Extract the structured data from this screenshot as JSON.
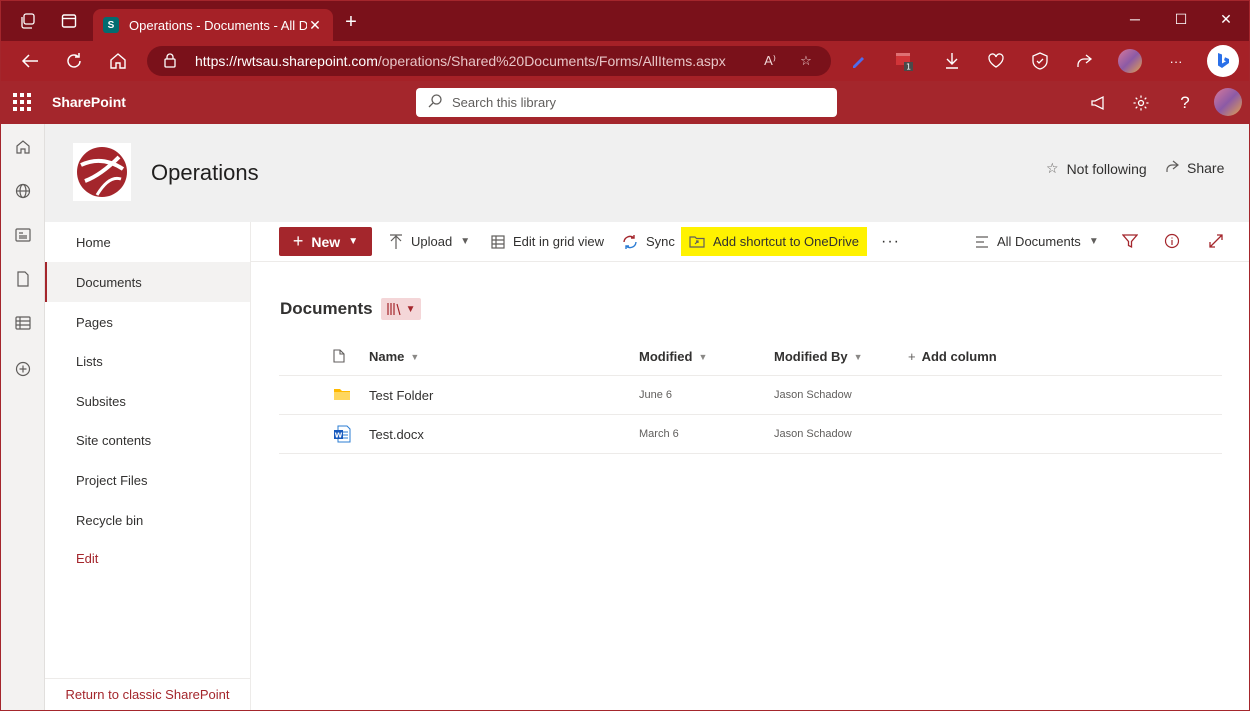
{
  "browser": {
    "tab_title": "Operations - Documents - All Do",
    "favicon_letter": "S",
    "url_host": "https://rwtsau.sharepoint.com",
    "url_path": "/operations/Shared%20Documents/Forms/AllItems.aspx",
    "ext_badge": "1"
  },
  "suite": {
    "brand": "SharePoint",
    "search_placeholder": "Search this library"
  },
  "site": {
    "title": "Operations",
    "follow_label": "Not following",
    "share_label": "Share"
  },
  "nav": {
    "items": [
      {
        "label": "Home"
      },
      {
        "label": "Documents"
      },
      {
        "label": "Pages"
      },
      {
        "label": "Lists"
      },
      {
        "label": "Subsites"
      },
      {
        "label": "Site contents"
      },
      {
        "label": "Project Files"
      },
      {
        "label": "Recycle bin"
      },
      {
        "label": "Edit"
      }
    ],
    "return_label": "Return to classic SharePoint"
  },
  "commands": {
    "new_label": "New",
    "upload_label": "Upload",
    "grid_label": "Edit in grid view",
    "sync_label": "Sync",
    "shortcut_label": "Add shortcut to OneDrive",
    "more_label": "···",
    "view_label": "All Documents"
  },
  "library": {
    "title": "Documents",
    "columns": {
      "name": "Name",
      "modified": "Modified",
      "modified_by": "Modified By",
      "add_column": "Add column"
    },
    "rows": [
      {
        "name": "Test Folder",
        "type": "folder",
        "modified": "June 6",
        "modified_by": "Jason Schadow"
      },
      {
        "name": "Test.docx",
        "type": "word",
        "modified": "March 6",
        "modified_by": "Jason Schadow"
      }
    ]
  },
  "colors": {
    "accent": "#a4262c",
    "chrome_dark": "#7a111a",
    "highlight": "#fff200"
  }
}
